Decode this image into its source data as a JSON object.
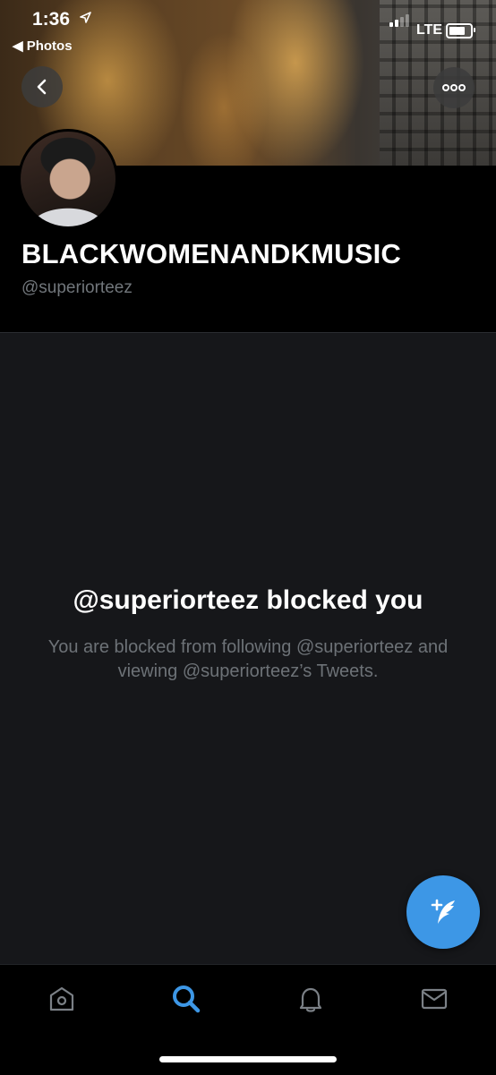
{
  "status_bar": {
    "time": "1:36",
    "location_arrow": "location-arrow-icon",
    "back_app_label": "◀ Photos",
    "network": "LTE"
  },
  "profile": {
    "display_name": "BLACKWOMENANDKMUSIC",
    "handle": "@superiorteez"
  },
  "blocked": {
    "title": "@superiorteez blocked you",
    "description": "You are blocked from following @superiorteez and viewing @superiorteez’s Tweets."
  },
  "icons": {
    "back": "chevron-left-icon",
    "more": "more-dots-icon",
    "compose": "compose-tweet-icon",
    "home": "home-icon",
    "search": "search-icon",
    "notifications": "bell-icon",
    "messages": "mail-icon"
  },
  "colors": {
    "accent": "#3d97e6",
    "background": "#16171a",
    "header": "#000000",
    "muted_text": "#71767b"
  }
}
